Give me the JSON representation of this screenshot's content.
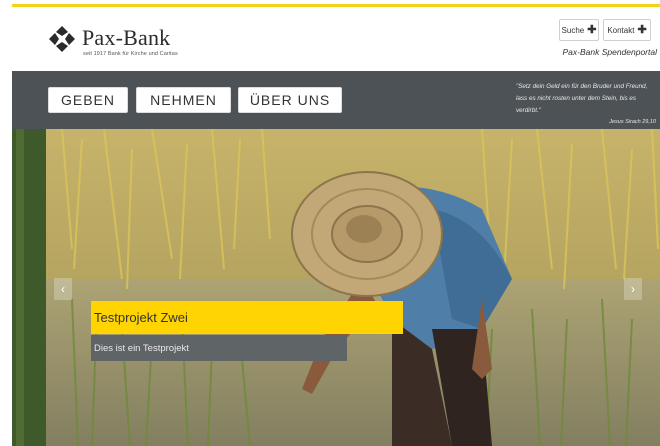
{
  "brand": {
    "name": "Pax-Bank",
    "tagline": "seit 1917 Bank für Kirche und Caritas",
    "accent_color": "#f3d21a"
  },
  "header": {
    "suche_label": "Suche",
    "kontakt_label": "Kontakt",
    "plus_icon": "plus-icon",
    "portal_title": "Pax-Bank Spendenportal"
  },
  "nav": {
    "items": [
      {
        "label": "GEBEN"
      },
      {
        "label": "NEHMEN"
      },
      {
        "label": "ÜBER UNS"
      }
    ],
    "bar_color": "#4d5256"
  },
  "quote": {
    "text": "\"Setz dein Geld ein für den Bruder und Freund, lass es nicht rosten unter dem Stein, bis es verdirbt.\"",
    "source": "Jesus Sirach 29,10"
  },
  "slider": {
    "prev_icon": "chevron-left-icon",
    "next_icon": "chevron-right-icon",
    "slide_title": "Testprojekt Zwei",
    "slide_subtitle": "Dies ist ein Testprojekt",
    "caption_color": "#ffd400"
  }
}
